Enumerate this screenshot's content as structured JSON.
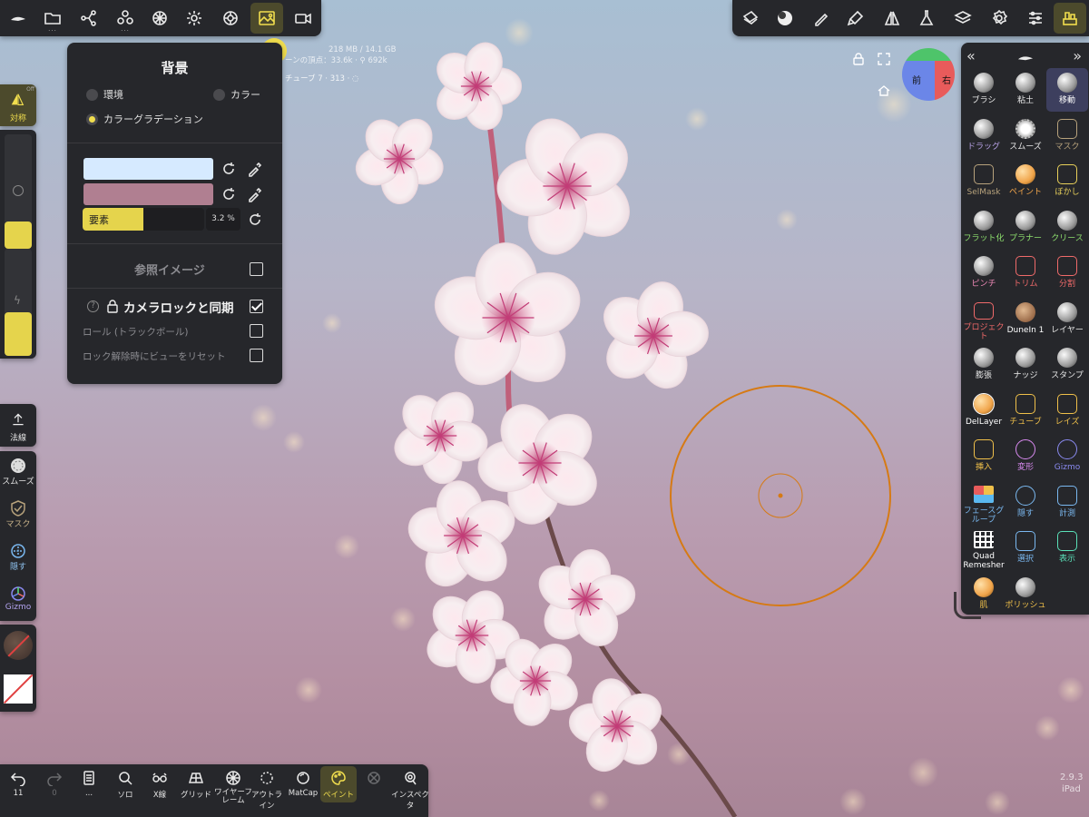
{
  "stats": {
    "memory": "218 MB / 14.1 GB",
    "scene_vertices": "ーンの頂点：33.6k · ⚲ 692k",
    "selected_object": "チューブ 7 · 313 · ◌"
  },
  "background_panel": {
    "title": "背景",
    "options": [
      "環境",
      "カラー",
      "カラーグラデーション"
    ],
    "selected_option": "カラーグラデーション",
    "color_top": "#d6eaff",
    "color_bottom": "#b07f91",
    "slider_label": "要素",
    "slider_value": "3.2 %",
    "slider_fraction": 0.5,
    "reference_image_label": "参照イメージ",
    "camera_lock_label": "カメラロックと同期",
    "camera_lock_checked": true,
    "roll_label": "ロール (トラックボール)",
    "reset_label": "ロック解除時にビューをリセット"
  },
  "left_toolbar": {
    "symmetry": "対称",
    "symmetry_badge": "Off",
    "normals": "法線",
    "smooth": "スムーズ",
    "mask": "マスク",
    "hide": "隠す",
    "gizmo": "Gizmo"
  },
  "tool_panel": {
    "tools": [
      {
        "label": "ブラシ",
        "color": "#e8e8e8",
        "icon": "sphere"
      },
      {
        "label": "粘土",
        "color": "#e8e8e8",
        "icon": "sphere"
      },
      {
        "label": "移動",
        "color": "#ffffff",
        "icon": "sphere"
      },
      {
        "label": "ドラッグ",
        "color": "#b9a3e8",
        "icon": "sphere"
      },
      {
        "label": "スムーズ",
        "color": "#e8e8e8",
        "icon": "gear"
      },
      {
        "label": "マスク",
        "color": "#b7a27c",
        "icon": "shield"
      },
      {
        "label": "SelMask",
        "color": "#b7a27c",
        "icon": "shield"
      },
      {
        "label": "ペイント",
        "color": "#f0a44a",
        "icon": "sphere-orange"
      },
      {
        "label": "ぼかし",
        "color": "#e8d05a",
        "icon": "tint"
      },
      {
        "label": "フラット化",
        "color": "#8ee06e",
        "icon": "sphere"
      },
      {
        "label": "プラナー",
        "color": "#8ee06e",
        "icon": "sphere"
      },
      {
        "label": "クリース",
        "color": "#8ee06e",
        "icon": "sphere"
      },
      {
        "label": "ピンチ",
        "color": "#f08ab8",
        "icon": "sphere"
      },
      {
        "label": "トリム",
        "color": "#f06a6a",
        "icon": "trim"
      },
      {
        "label": "分割",
        "color": "#f06a6a",
        "icon": "split"
      },
      {
        "label": "プロジェクト",
        "color": "#f06a6a",
        "icon": "project"
      },
      {
        "label": "DuneIn 1",
        "color": "#ffffff",
        "icon": "dune"
      },
      {
        "label": "レイヤー",
        "color": "#e8e8e8",
        "icon": "sphere"
      },
      {
        "label": "膨張",
        "color": "#e8e8e8",
        "icon": "sphere"
      },
      {
        "label": "ナッジ",
        "color": "#e8e8e8",
        "icon": "sphere"
      },
      {
        "label": "スタンプ",
        "color": "#e8e8e8",
        "icon": "sphere"
      },
      {
        "label": "DelLayer",
        "color": "#ffffff",
        "icon": "del"
      },
      {
        "label": "チューブ",
        "color": "#f0c04a",
        "icon": "tube"
      },
      {
        "label": "レイズ",
        "color": "#f0c04a",
        "icon": "vase"
      },
      {
        "label": "挿入",
        "color": "#f0c04a",
        "icon": "insert"
      },
      {
        "label": "変形",
        "color": "#d88af0",
        "icon": "transform"
      },
      {
        "label": "Gizmo",
        "color": "#8a8af0",
        "icon": "gizmo"
      },
      {
        "label": "フェースグループ",
        "color": "#7ab8f0",
        "icon": "faces"
      },
      {
        "label": "隠す",
        "color": "#7ab8f0",
        "icon": "hide"
      },
      {
        "label": "計測",
        "color": "#7ab8f0",
        "icon": "ruler"
      },
      {
        "label": "Quad Remesher",
        "color": "#ffffff",
        "icon": "grid"
      },
      {
        "label": "選択",
        "color": "#7ab8f0",
        "icon": "select"
      },
      {
        "label": "表示",
        "color": "#5ae0b8",
        "icon": "camera"
      },
      {
        "label": "肌",
        "color": "#f0c04a",
        "icon": "sphere-orange"
      },
      {
        "label": "ポリッシュ",
        "color": "#f0c04a",
        "icon": "sphere"
      }
    ],
    "selected": "移動"
  },
  "bottom_bar": {
    "undo_count": "11",
    "redo_count": "0",
    "items": [
      "ソロ",
      "X線",
      "グリッド",
      "ワイヤーフレーム",
      "アウトライン",
      "MatCap",
      "ペイント",
      "",
      "インスペクタ"
    ],
    "file_dots": "..."
  },
  "gizmo_cube": {
    "front": "前",
    "right": "右"
  },
  "version": "2.9.3",
  "device": "iPad"
}
